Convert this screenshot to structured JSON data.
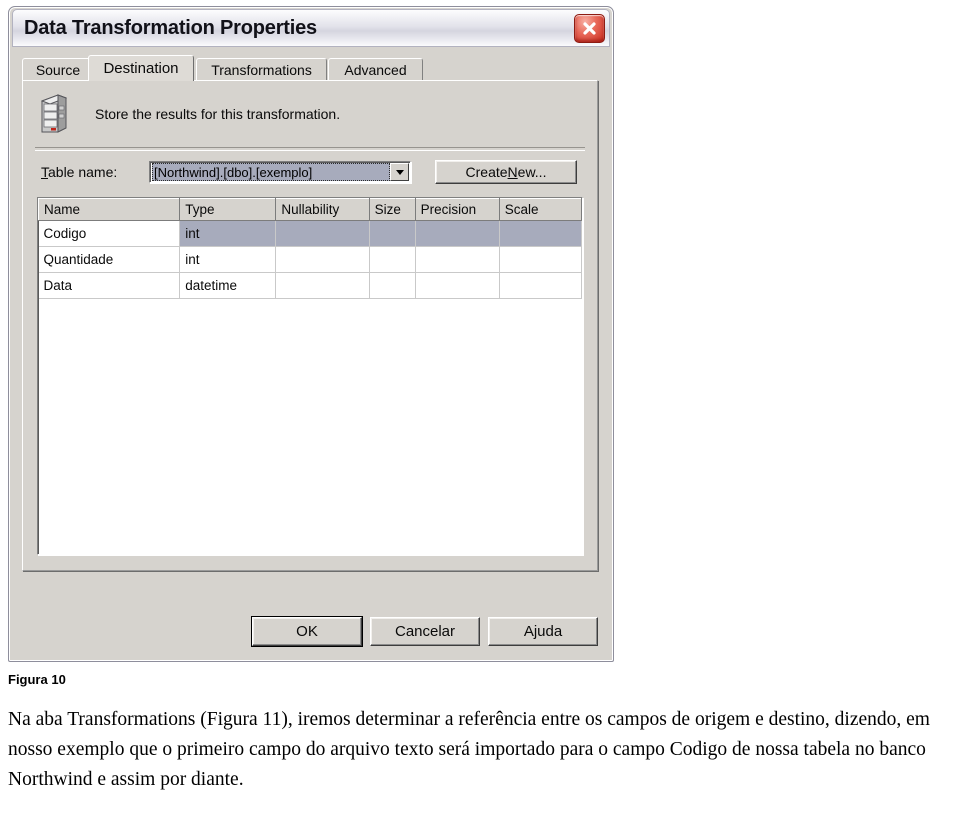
{
  "window": {
    "title": "Data Transformation Properties",
    "close_icon": "close-icon",
    "close_tooltip": "Close"
  },
  "tabs": [
    {
      "label": "Source",
      "active": false
    },
    {
      "label": "Destination",
      "active": true
    },
    {
      "label": "Transformations",
      "active": false
    },
    {
      "label": "Advanced",
      "active": false
    }
  ],
  "destination_page": {
    "icon": "server-icon",
    "description": "Store the results for this transformation.",
    "table_name": {
      "label_prefix": "",
      "label_accel": "T",
      "label_suffix": "able name:",
      "value": "[Northwind].[dbo].[exemplo]",
      "dropdown_icon": "chevron-down-icon"
    },
    "create_new_button": {
      "prefix": "Create ",
      "accel": "N",
      "suffix": "ew..."
    },
    "grid": {
      "columns": [
        "Name",
        "Type",
        "Nullability",
        "Size",
        "Precision",
        "Scale"
      ],
      "rows": [
        {
          "cells": [
            "Codigo",
            "int",
            "",
            "",
            "",
            ""
          ],
          "selected": true
        },
        {
          "cells": [
            "Quantidade",
            "int",
            "",
            "",
            "",
            ""
          ],
          "selected": false
        },
        {
          "cells": [
            "Data",
            "datetime",
            "",
            "",
            "",
            ""
          ],
          "selected": false
        }
      ]
    }
  },
  "dialog_buttons": [
    {
      "label": "OK",
      "default": true
    },
    {
      "label": "Cancelar",
      "default": false
    },
    {
      "label": "Ajuda",
      "default": false
    }
  ],
  "document": {
    "figure_caption": "Figura 10",
    "paragraph": "Na aba Transformations (Figura 11), iremos determinar a referência entre os campos de origem e destino, dizendo, em nosso exemplo que o primeiro campo do arquivo texto será importado para o campo Codigo de nossa tabela no banco Northwind e assim por diante."
  },
  "colors": {
    "dialog_face": "#d6d3ce",
    "selection": "#a7abbc",
    "close_button": "#c8291c",
    "text": "#0a0a0a"
  }
}
